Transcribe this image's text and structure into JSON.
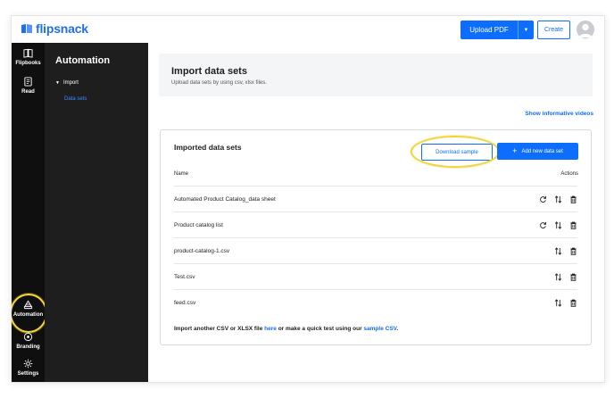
{
  "app": {
    "logo_text": "flipsnack",
    "brand_color": "#1f6fec",
    "accent_color": "#0d6efd",
    "highlight_color": "#f2d43b"
  },
  "topbar": {
    "upload_label": "Upload PDF",
    "create_label": "Create"
  },
  "rail": {
    "items": [
      {
        "label": "Flipbooks",
        "icon": "book-icon"
      },
      {
        "label": "Read",
        "icon": "read-icon"
      },
      {
        "label": "Automation",
        "icon": "automation-icon"
      },
      {
        "label": "Branding",
        "icon": "branding-icon"
      },
      {
        "label": "Settings",
        "icon": "gear-icon"
      }
    ]
  },
  "subpanel": {
    "title": "Automation",
    "group": "Import",
    "active_item": "Data sets"
  },
  "page": {
    "title": "Import data sets",
    "subtitle": "Upload data sets by using csv, xlsx files.",
    "videos_link": "Show informative videos"
  },
  "datasets": {
    "card_title": "Imported data sets",
    "download_label": "Download sample",
    "add_label": "Add new data set",
    "columns": {
      "name": "Name",
      "actions": "Actions"
    },
    "rows": [
      {
        "name": "Automated Product Catalog_data sheet",
        "refresh": true
      },
      {
        "name": "Product catalog list",
        "refresh": true
      },
      {
        "name": "product-catalog-1.csv",
        "refresh": false
      },
      {
        "name": "Test.csv",
        "refresh": false
      },
      {
        "name": "feed.csv",
        "refresh": false
      }
    ],
    "footer": {
      "prefix": "Import another CSV or XLSX file",
      "link1": "here",
      "middle": "or make a quick test using our",
      "link2": "sample CSV",
      "suffix": "."
    }
  }
}
